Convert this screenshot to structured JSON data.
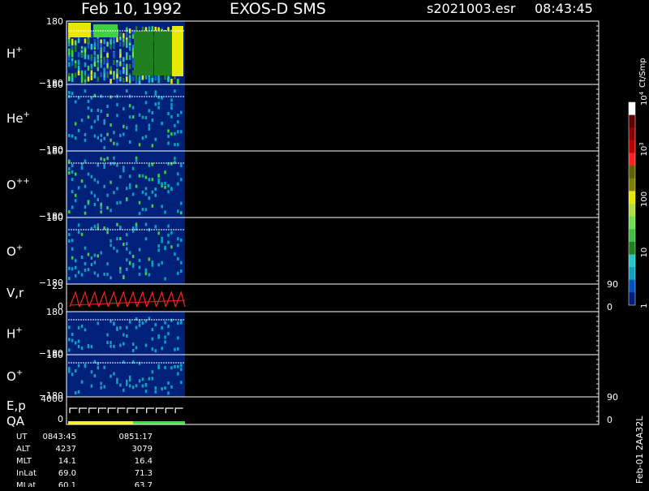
{
  "header": {
    "date": "Feb 10, 1992",
    "instrument": "EXOS-D SMS",
    "file": "s2021003.esr",
    "time": "08:43:45"
  },
  "colors": {
    "background": "#000000",
    "fill": "#00207a",
    "axis": "#ffffff",
    "velocity_trace": "#ff2020",
    "qa_yellow": "#f8f400",
    "qa_green": "#40e040"
  },
  "chart_data": [
    {
      "type": "heatmap",
      "panel": "H+ pitch angle",
      "ylabel_base": "H",
      "ylabel_sup": "+",
      "yticks": [
        "180",
        "−180"
      ],
      "ylim": [
        -180,
        180
      ],
      "x_extent_fraction": [
        0,
        0.22
      ],
      "dominant_levels": [
        "10",
        "100"
      ],
      "note_colors": [
        "#00207a",
        "#10a0c0",
        "#40d040",
        "#e8e800",
        "#208020"
      ]
    },
    {
      "type": "heatmap",
      "panel": "He+ pitch angle",
      "ylabel_base": "He",
      "ylabel_sup": "+",
      "yticks": [
        "180",
        "−180"
      ],
      "ylim": [
        -180,
        180
      ],
      "x_extent_fraction": [
        0,
        0.22
      ]
    },
    {
      "type": "heatmap",
      "panel": "O++ pitch angle",
      "ylabel_base": "O",
      "ylabel_sup": "++",
      "yticks": [
        "180",
        "−180"
      ],
      "ylim": [
        -180,
        180
      ],
      "x_extent_fraction": [
        0,
        0.22
      ]
    },
    {
      "type": "heatmap",
      "panel": "O+ pitch angle",
      "ylabel_base": "O",
      "ylabel_sup": "+",
      "yticks": [
        "180",
        "−180"
      ],
      "ylim": [
        -180,
        180
      ],
      "x_extent_fraction": [
        0,
        0.22
      ]
    },
    {
      "type": "line",
      "panel": "V,r",
      "ylabel": "V,r",
      "yticks_left": [
        "25",
        "0"
      ],
      "yticks_right": [
        "90",
        "0"
      ],
      "ylim": [
        0,
        25
      ],
      "sawtooth_cycles": 12
    },
    {
      "type": "heatmap",
      "panel": "H+ (second)",
      "ylabel_base": "H",
      "ylabel_sup": "+",
      "yticks": [
        "180",
        "−180"
      ],
      "ylim": [
        -180,
        180
      ]
    },
    {
      "type": "heatmap",
      "panel": "O+ (second)",
      "ylabel_base": "O",
      "ylabel_sup": "+",
      "yticks": [
        "180",
        "−180"
      ],
      "ylim": [
        -180,
        180
      ]
    },
    {
      "type": "line",
      "panel": "E,p QA",
      "ylabel": "E,p",
      "ylabel2": "QA",
      "yticks_left": [
        "4000",
        "0"
      ],
      "yticks_right": [
        "90",
        "0"
      ],
      "ylim": [
        0,
        4000
      ],
      "sawtooth_cycles": 12
    }
  ],
  "colorbar": {
    "title": "Ct/Smp",
    "labels": [
      {
        "text": "1",
        "level": 0.0
      },
      {
        "text": "10",
        "level": 0.25
      },
      {
        "text": "100",
        "level": 0.5
      },
      {
        "text": "10",
        "sup": "3",
        "level": 0.75
      },
      {
        "text": "10",
        "sup": "4",
        "level": 1.0
      }
    ],
    "stops": [
      "#00207a",
      "#0050c0",
      "#10a0c0",
      "#20c8c8",
      "#208020",
      "#40c040",
      "#70e050",
      "#b0e040",
      "#e8e800",
      "#808000",
      "#606000",
      "#ff2020",
      "#c00000",
      "#900000",
      "#600000",
      "#ffffff"
    ]
  },
  "orbit": {
    "rows": [
      {
        "label": "UT",
        "v1": "0843:45",
        "v2": "0851:17"
      },
      {
        "label": "ALT",
        "v1": "4237",
        "v2": "3079"
      },
      {
        "label": "MLT",
        "v1": "14.1",
        "v2": "16.4"
      },
      {
        "label": "InLat",
        "v1": "69.0",
        "v2": "71.3"
      },
      {
        "label": "MLat",
        "v1": "60.1",
        "v2": "63.7"
      }
    ]
  },
  "footer": {
    "id": "Feb-01 2AA32L"
  }
}
